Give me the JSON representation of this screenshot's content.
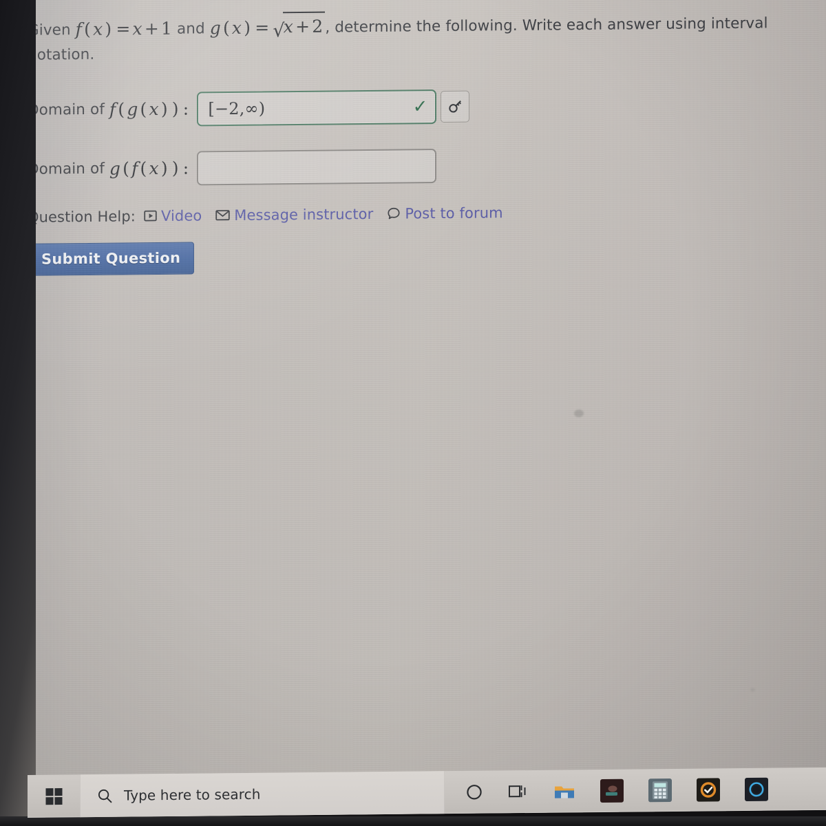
{
  "question": {
    "intro": "Given",
    "f_def": "f(x) = x + 1",
    "conjunction": "and",
    "g_def": "g(x) = √(x + 2)",
    "instruction": ", determine the following. Write each answer using interval notation.",
    "f_name": "f",
    "g_name": "g",
    "var": "x",
    "f_expr_rhs": "x + 1",
    "g_radicand": "x + 2",
    "tail_line1": ", determine the following. Write each answer using interval",
    "tail_line2": "notation."
  },
  "answers": [
    {
      "label_prefix": "Domain of",
      "label_math": "f(g(x)):",
      "outer": "f",
      "inner": "g",
      "value": "[−2,∞)",
      "placeholder": "",
      "status": "correct",
      "check_glyph": "✓",
      "has_key_button": true,
      "key_icon": "math-keyboard-icon"
    },
    {
      "label_prefix": "Domain of",
      "label_math": "g(f(x)):",
      "outer": "g",
      "inner": "f",
      "value": "",
      "placeholder": "",
      "status": "empty",
      "check_glyph": "",
      "has_key_button": false,
      "key_icon": ""
    }
  ],
  "help": {
    "label": "Question Help:",
    "links": [
      {
        "text": "Video",
        "icon": "video-icon"
      },
      {
        "text": "Message instructor",
        "icon": "envelope-icon"
      },
      {
        "text": "Post to forum",
        "icon": "speech-bubble-icon"
      }
    ]
  },
  "submit": {
    "label": "Submit Question"
  },
  "taskbar": {
    "start_icon": "windows-start-icon",
    "search_icon": "search-icon",
    "search_placeholder": "Type here to search",
    "items": [
      {
        "icon": "cortana-circle-icon",
        "name": "cortana"
      },
      {
        "icon": "task-view-icon",
        "name": "task-view"
      },
      {
        "icon": "file-explorer-icon",
        "name": "file-explorer"
      },
      {
        "icon": "dark-app-icon",
        "name": "media-app"
      },
      {
        "icon": "calculator-icon",
        "name": "calculator"
      },
      {
        "icon": "check-badge-icon",
        "name": "antivirus"
      },
      {
        "icon": "blue-ring-icon",
        "name": "blue-ring-app"
      }
    ]
  },
  "colors": {
    "page_bg": "#c6c1bd",
    "text": "#3b3d42",
    "math_text": "#2f3135",
    "link": "#5a5ca8",
    "correct_border": "#4c7a63",
    "check": "#2c6b4a",
    "empty_border": "#8d8a87",
    "submit_bg": "#4b6ba4",
    "taskbar_bg": "#c7c3bf"
  }
}
